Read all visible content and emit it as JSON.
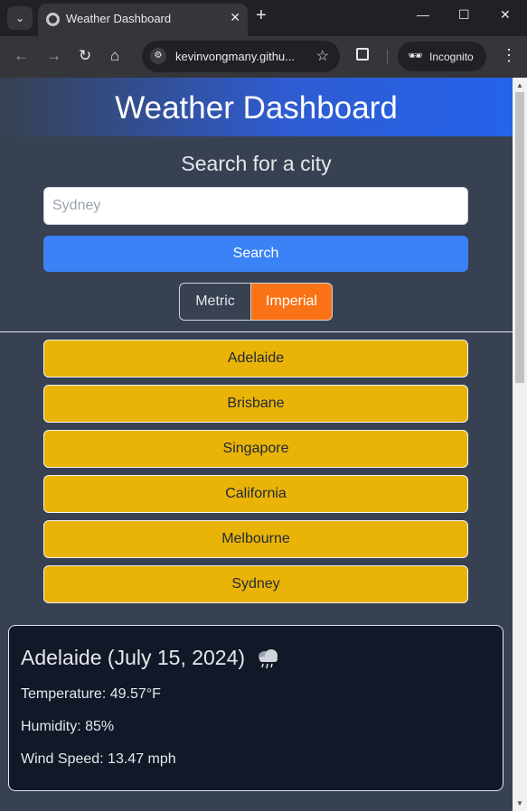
{
  "browser": {
    "tab_title": "Weather Dashboard",
    "tab_close_glyph": "✕",
    "new_tab_glyph": "+",
    "minimize_glyph": "—",
    "maximize_glyph": "☐",
    "close_glyph": "✕",
    "url": "kevinvongmany.githu...",
    "incognito_label": "Incognito"
  },
  "page": {
    "header_title": "Weather Dashboard",
    "search_label": "Search for a city",
    "search_placeholder": "Sydney",
    "search_button": "Search",
    "units": {
      "metric": "Metric",
      "imperial": "Imperial",
      "selected": "Imperial"
    },
    "history": [
      "Adelaide",
      "Brisbane",
      "Singapore",
      "California",
      "Melbourne",
      "Sydney"
    ],
    "current_weather": {
      "title": "Adelaide (July 15, 2024)",
      "icon": "rain-cloud-icon",
      "temperature": "Temperature: 49.57°F",
      "humidity": "Humidity: 85%",
      "wind": "Wind Speed: 13.47 mph"
    }
  },
  "colors": {
    "page_bg": "#374151",
    "header_accent": "#2563eb",
    "search_button": "#3b82f6",
    "imperial_active": "#f97316",
    "history_button": "#eab308",
    "card_bg": "#111827"
  }
}
